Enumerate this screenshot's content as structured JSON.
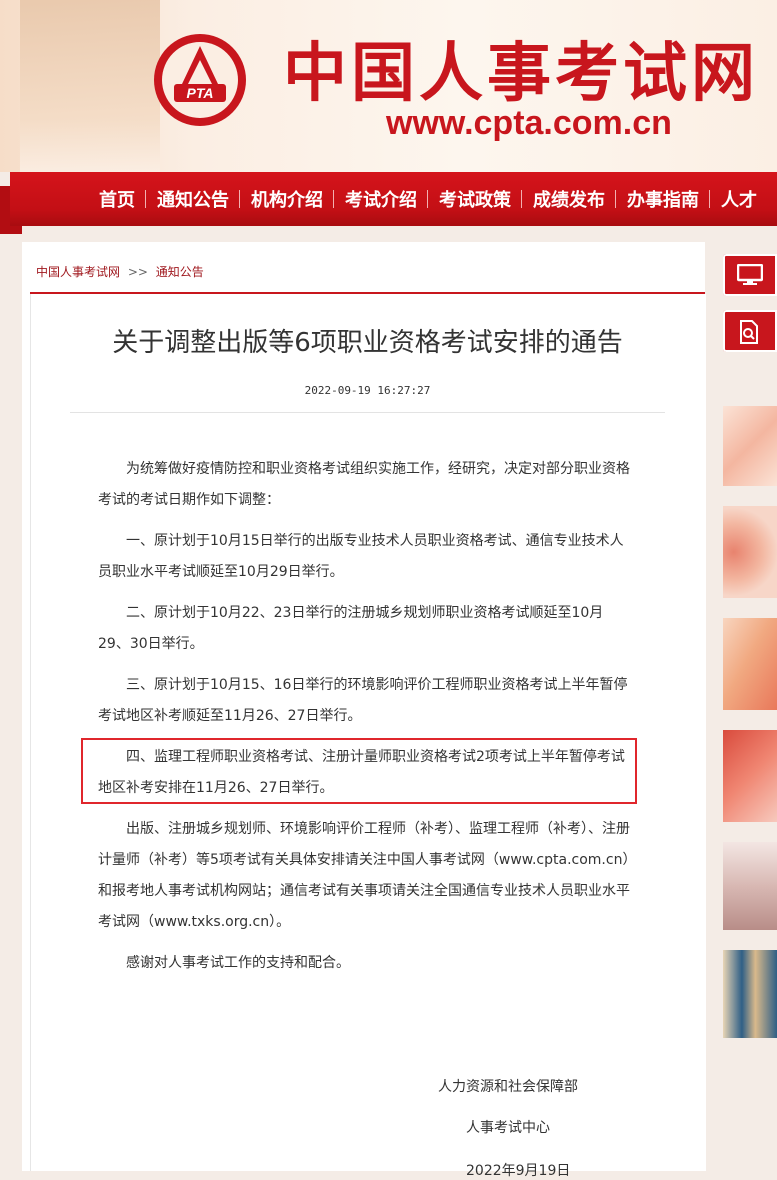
{
  "header": {
    "site_title": "中国人事考试网",
    "site_url": "www.cpta.com.cn",
    "logo_text": "PTA"
  },
  "nav": {
    "items": [
      "首页",
      "通知公告",
      "机构介绍",
      "考试介绍",
      "考试政策",
      "成绩发布",
      "办事指南",
      "人才"
    ]
  },
  "breadcrumb": {
    "home": "中国人事考试网",
    "separator": ">>",
    "current": "通知公告"
  },
  "article": {
    "title": "关于调整出版等6项职业资格考试安排的通告",
    "date": "2022-09-19 16:27:27",
    "paragraphs": [
      "为统筹做好疫情防控和职业资格考试组织实施工作，经研究，决定对部分职业资格考试的考试日期作如下调整：",
      "一、原计划于10月15日举行的出版专业技术人员职业资格考试、通信专业技术人员职业水平考试顺延至10月29日举行。",
      "二、原计划于10月22、23日举行的注册城乡规划师职业资格考试顺延至10月29、30日举行。",
      "三、原计划于10月15、16日举行的环境影响评价工程师职业资格考试上半年暂停考试地区补考顺延至11月26、27日举行。",
      "四、监理工程师职业资格考试、注册计量师职业资格考试2项考试上半年暂停考试地区补考安排在11月26、27日举行。",
      "出版、注册城乡规划师、环境影响评价工程师（补考）、监理工程师（补考）、注册计量师（补考）等5项考试有关具体安排请关注中国人事考试网（www.cpta.com.cn）和报考地人事考试机构网站；通信考试有关事项请关注全国通信专业技术人员职业水平考试网（www.txks.org.cn）。",
      "感谢对人事考试工作的支持和配合。"
    ],
    "signature_org": "人力资源和社会保障部",
    "signature_center": "人事考试中心",
    "signature_date": "2022年9月19日"
  },
  "sidebar": {
    "btn1_icon": "monitor-icon",
    "btn2_icon": "search-document-icon"
  },
  "colors": {
    "brand_red": "#c8161d",
    "highlight_border": "#e0262c"
  }
}
